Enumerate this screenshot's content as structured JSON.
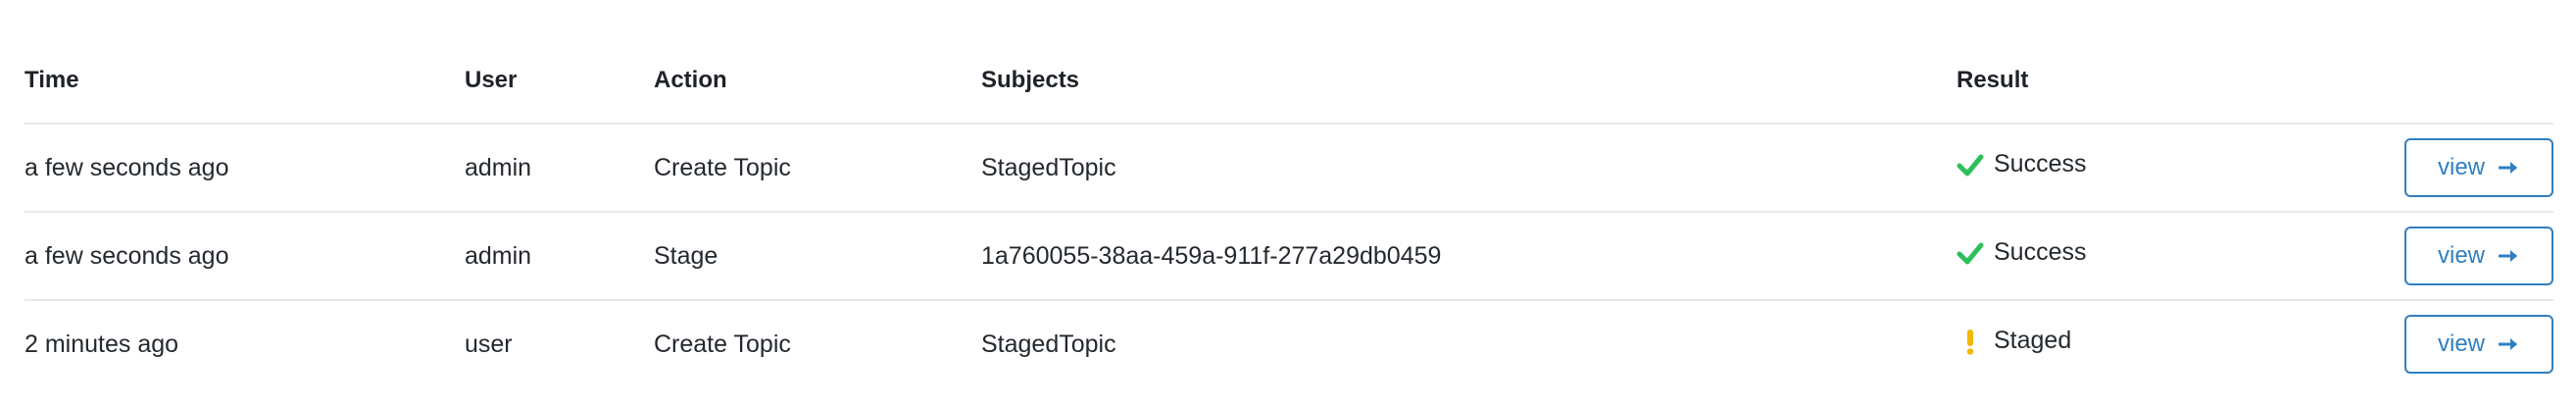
{
  "table": {
    "headers": {
      "time": "Time",
      "user": "User",
      "action": "Action",
      "subjects": "Subjects",
      "result": "Result"
    },
    "rows": [
      {
        "time": "a few seconds ago",
        "user": "admin",
        "action": "Create Topic",
        "subjects": "StagedTopic",
        "result": "Success",
        "result_status": "success",
        "button_label": "view"
      },
      {
        "time": "a few seconds ago",
        "user": "admin",
        "action": "Stage",
        "subjects": "1a760055-38aa-459a-911f-277a29db0459",
        "result": "Success",
        "result_status": "success",
        "button_label": "view"
      },
      {
        "time": "2 minutes ago",
        "user": "user",
        "action": "Create Topic",
        "subjects": "StagedTopic",
        "result": "Staged",
        "result_status": "staged",
        "button_label": "view"
      }
    ]
  },
  "colors": {
    "success": "#2dbf5a",
    "staged": "#f2b705",
    "accent": "#2f7fc1",
    "divider": "#e6e8eb"
  },
  "icons": {
    "success": "checkmark-icon",
    "staged": "exclamation-icon",
    "button": "arrow-right-icon"
  }
}
